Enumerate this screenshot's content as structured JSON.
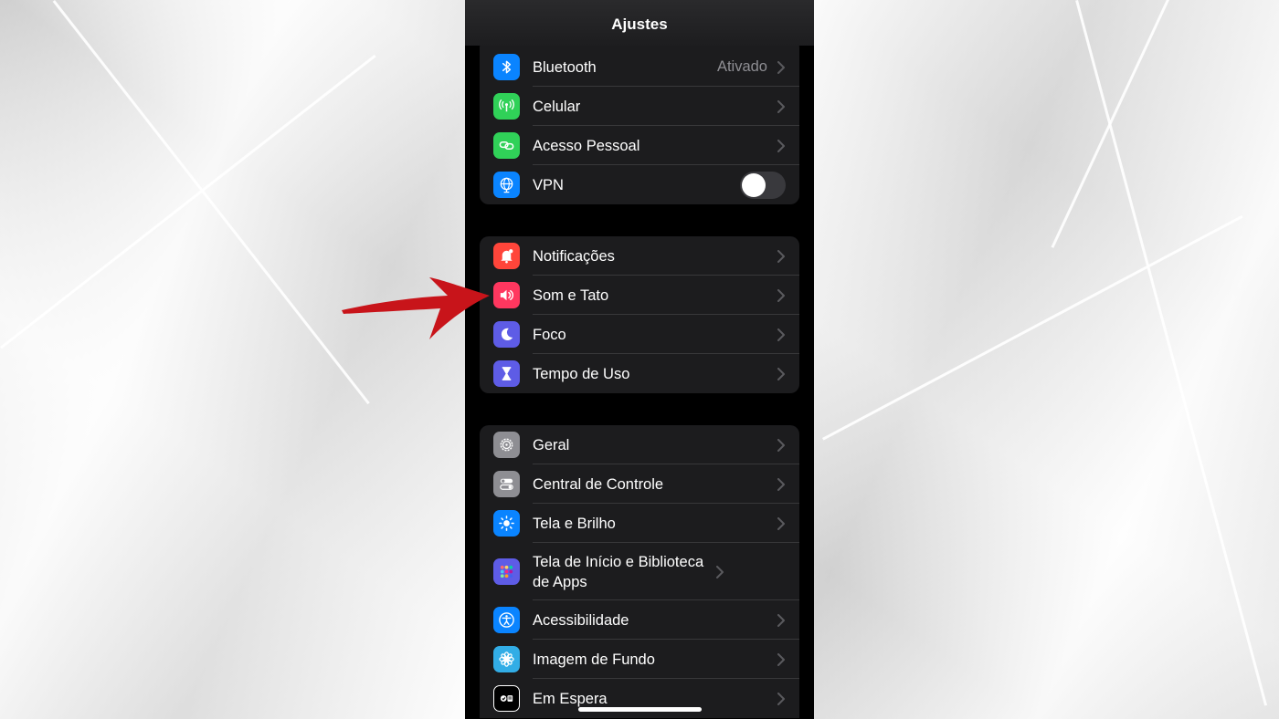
{
  "navbar": {
    "title": "Ajustes"
  },
  "groups": [
    {
      "items": [
        {
          "label": "Bluetooth",
          "value": "Ativado"
        },
        {
          "label": "Celular"
        },
        {
          "label": "Acesso Pessoal"
        },
        {
          "label": "VPN",
          "toggle": "off"
        }
      ]
    },
    {
      "items": [
        {
          "label": "Notificações"
        },
        {
          "label": "Som e Tato"
        },
        {
          "label": "Foco"
        },
        {
          "label": "Tempo de Uso"
        }
      ]
    },
    {
      "items": [
        {
          "label": "Geral"
        },
        {
          "label": "Central de Controle"
        },
        {
          "label": "Tela e Brilho"
        },
        {
          "label": "Tela de Início e Biblioteca de Apps"
        },
        {
          "label": "Acessibilidade"
        },
        {
          "label": "Imagem de Fundo"
        },
        {
          "label": "Em Espera"
        }
      ]
    }
  ],
  "colors": {
    "bluetooth": "#0a84ff",
    "celular": "#30d158",
    "acesso_pessoal": "#30d158",
    "vpn": "#0a84ff",
    "notificacoes": "#ff453a",
    "som": "#ff375f",
    "foco": "#5e5ce6",
    "tempo": "#5e5ce6",
    "geral": "#8e8e93",
    "central": "#8e8e93",
    "tela_brilho": "#0a84ff",
    "tela_inicio": "#5e5ce6",
    "acessibilidade": "#0a84ff",
    "imagem_fundo": "#32ade6",
    "em_espera": "#000000",
    "annotation_arrow": "#c8141a"
  }
}
